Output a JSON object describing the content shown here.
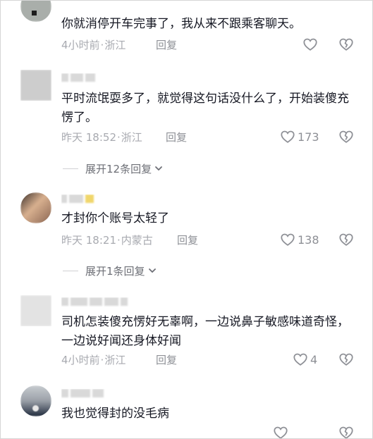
{
  "comments": [
    {
      "text": "你就消停开车完事了，我从来不跟乘客聊天。",
      "time": "4小时前",
      "location": "浙江",
      "reply": "回复",
      "likes": ""
    },
    {
      "text": "平时流氓耍多了，就觉得这句话没什么了，开始装傻充愣了。",
      "time": "昨天 18:52",
      "location": "浙江",
      "reply": "回复",
      "likes": "173",
      "expand": "展开12条回复"
    },
    {
      "text": "才封你个账号太轻了",
      "time": "昨天 18:21",
      "location": "内蒙古",
      "reply": "回复",
      "likes": "138",
      "expand": "展开1条回复"
    },
    {
      "text": "司机怎装傻充愣好无辜啊，一边说鼻子敏感味道奇怪，一边说好闻还身体好闻",
      "time": "4小时前",
      "location": "浙江",
      "reply": "回复",
      "likes": "4"
    },
    {
      "text": "我也觉得封的没毛病",
      "time": "",
      "location": "",
      "reply": "",
      "likes": ""
    }
  ],
  "colors": {
    "text": "#161823",
    "meta": "#a8aab0",
    "icon": "#8e9096"
  },
  "icons": {
    "like": "heart-outline-icon",
    "dislike": "broken-heart-icon",
    "expand": "chevron-down-icon"
  }
}
